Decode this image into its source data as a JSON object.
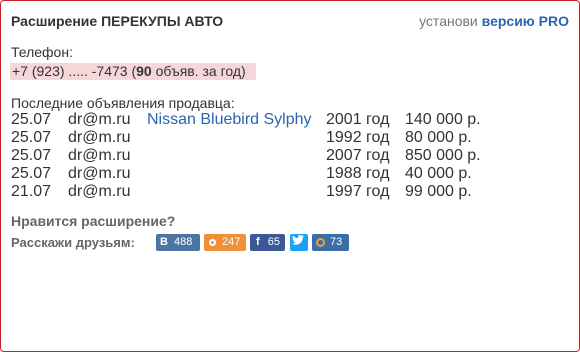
{
  "header": {
    "title": "Расширение ПЕРЕКУПЫ АВТО",
    "install_prefix": "установи",
    "install_link": "версию PRO"
  },
  "phone": {
    "label": "Телефон:",
    "number": "+7 (923) ..... -7473",
    "ads_count_open": " (",
    "ads_count": "90",
    "ads_count_suffix": " объяв. за год)"
  },
  "recent": {
    "label": "Последние объявления продавца:",
    "rows": [
      {
        "date": "25.07",
        "user": "dr@m.ru",
        "model": "Nissan Bluebird Sylphy",
        "year": "2001 год",
        "price": "140 000 р."
      },
      {
        "date": "25.07",
        "user": "dr@m.ru",
        "model": "",
        "year": "1992 год",
        "price": "80 000 р."
      },
      {
        "date": "25.07",
        "user": "dr@m.ru",
        "model": "",
        "year": "2007 год",
        "price": "850 000 р."
      },
      {
        "date": "25.07",
        "user": "dr@m.ru",
        "model": "",
        "year": "1988 год",
        "price": "40 000 р."
      },
      {
        "date": "21.07",
        "user": "dr@m.ru",
        "model": "",
        "year": "1997 год",
        "price": "99 000 р."
      }
    ]
  },
  "like": {
    "question": "Нравится расширение?",
    "share_label": "Расскажи друзьям:"
  },
  "share": {
    "vk": {
      "icon": "vk-icon",
      "glyph": "В",
      "count": "488",
      "color": "#4c75a3"
    },
    "ok": {
      "icon": "odnoklassniki-icon",
      "count": "247",
      "color": "#f0913a"
    },
    "fb": {
      "icon": "facebook-icon",
      "glyph": "f",
      "count": "65",
      "color": "#3b5998"
    },
    "tw": {
      "icon": "twitter-icon",
      "color": "#1da1f2"
    },
    "mm": {
      "icon": "mailru-icon",
      "count": "73",
      "color": "#3b6ea8"
    }
  },
  "colors": {
    "border": "#c8202a",
    "link": "#2a65b0",
    "phone_highlight": "#f6d7d9"
  }
}
